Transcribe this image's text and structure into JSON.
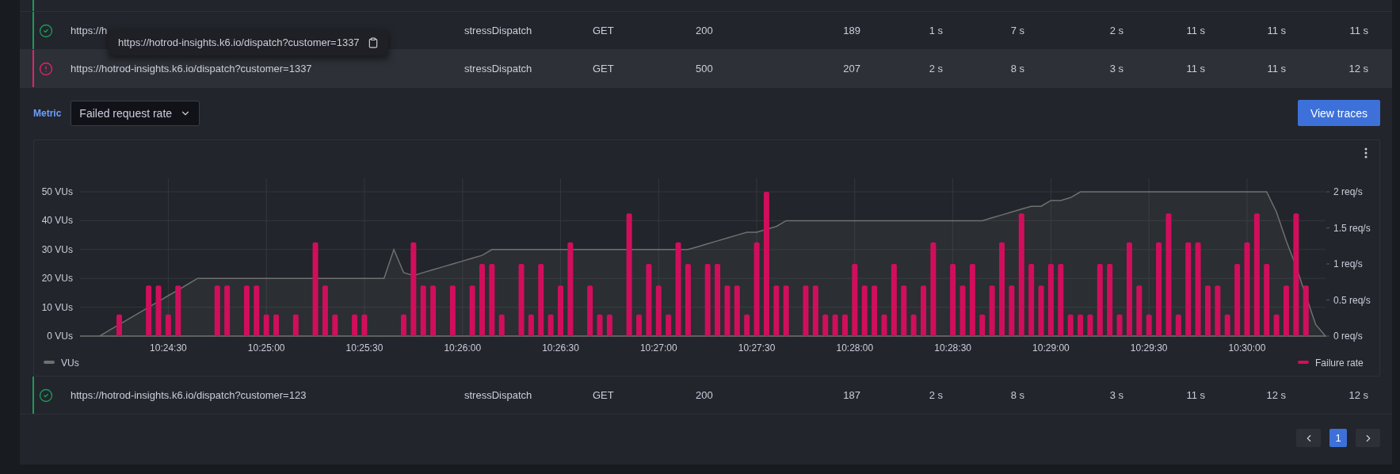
{
  "previous_row": {
    "color": "#1a9a5a"
  },
  "tooltip": {
    "text": "https://hotrod-insights.k6.io/dispatch?customer=1337"
  },
  "table": {
    "rows": [
      {
        "kind": "success",
        "color": "#1a9a5a",
        "expanded": false,
        "cells": [
          "https://h",
          "stressDispatch",
          "GET",
          "200",
          "189",
          "1 s",
          "7 s",
          "2 s",
          "11 s",
          "11 s",
          "11 s"
        ]
      },
      {
        "kind": "error",
        "color": "#e0226e",
        "expanded": true,
        "cells": [
          "https://hotrod-insights.k6.io/dispatch?customer=1337",
          "stressDispatch",
          "GET",
          "500",
          "207",
          "2 s",
          "8 s",
          "3 s",
          "11 s",
          "11 s",
          "12 s"
        ]
      },
      {
        "kind": "success",
        "color": "#1a9a5a",
        "expanded": false,
        "cells": [
          "https://hotrod-insights.k6.io/dispatch?customer=123",
          "stressDispatch",
          "GET",
          "200",
          "187",
          "2 s",
          "8 s",
          "3 s",
          "11 s",
          "12 s",
          "12 s"
        ]
      }
    ]
  },
  "detail": {
    "metric_label": "Metric",
    "metric_select": {
      "value": "Failed request rate"
    },
    "view_traces_button": "View traces",
    "chart_data": {
      "type": "bar",
      "grid": true,
      "legend": "bottom",
      "ylim": [
        0,
        50
      ],
      "y2lim": [
        0,
        2
      ],
      "categories": [
        null,
        null,
        null,
        null,
        null,
        null,
        null,
        null,
        null,
        "10:24:30",
        null,
        null,
        null,
        null,
        null,
        null,
        null,
        null,
        null,
        "10:25:00",
        null,
        null,
        null,
        null,
        null,
        null,
        null,
        null,
        null,
        "10:25:30",
        null,
        null,
        null,
        null,
        null,
        null,
        null,
        null,
        null,
        "10:26:00",
        null,
        null,
        null,
        null,
        null,
        null,
        null,
        null,
        null,
        "10:26:30",
        null,
        null,
        null,
        null,
        null,
        null,
        null,
        null,
        null,
        "10:27:00",
        null,
        null,
        null,
        null,
        null,
        null,
        null,
        null,
        null,
        "10:27:30",
        null,
        null,
        null,
        null,
        null,
        null,
        null,
        null,
        null,
        "10:28:00",
        null,
        null,
        null,
        null,
        null,
        null,
        null,
        null,
        null,
        "10:28:30",
        null,
        null,
        null,
        null,
        null,
        null,
        null,
        null,
        null,
        "10:29:00",
        null,
        null,
        null,
        null,
        null,
        null,
        null,
        null,
        null,
        "10:29:30",
        null,
        null,
        null,
        null,
        null,
        null,
        null,
        null,
        null,
        "10:30:00",
        null,
        null,
        null,
        null,
        null,
        null,
        null,
        null
      ],
      "yticks": [
        {
          "value": 0,
          "label": "0 VUs"
        },
        {
          "value": 10,
          "label": "10 VUs"
        },
        {
          "value": 20,
          "label": "20 VUs"
        },
        {
          "value": 30,
          "label": "30 VUs"
        },
        {
          "value": 40,
          "label": "40 VUs"
        },
        {
          "value": 50,
          "label": "50 VUs"
        }
      ],
      "y2ticks": [
        {
          "value": 0,
          "label": "0 req/s"
        },
        {
          "value": 0.5,
          "label": "0.5 req/s"
        },
        {
          "value": 1,
          "label": "1 req/s"
        },
        {
          "value": 1.5,
          "label": "1.5 req/s"
        },
        {
          "value": 2,
          "label": "2 req/s"
        }
      ],
      "series": [
        {
          "name": "VUs",
          "type": "area",
          "color": "#707070",
          "values": [
            0,
            0,
            0,
            2,
            4,
            6,
            8,
            10,
            12,
            14,
            16,
            18,
            20,
            20,
            20,
            20,
            20,
            20,
            20,
            20,
            20,
            20,
            20,
            20,
            20,
            20,
            20,
            20,
            20,
            20,
            20,
            20,
            30,
            22,
            21,
            22,
            23,
            24,
            25,
            26,
            27,
            28,
            30,
            30,
            30,
            30,
            30,
            30,
            30,
            30,
            30,
            30,
            30,
            30,
            30,
            30,
            30,
            30,
            30,
            30,
            30,
            30,
            30,
            31,
            32,
            33,
            34,
            35,
            36,
            36,
            37,
            38,
            40,
            40,
            40,
            40,
            40,
            40,
            40,
            40,
            40,
            40,
            40,
            40,
            40,
            40,
            40,
            40,
            40,
            40,
            40,
            40,
            40,
            41,
            42,
            43,
            44,
            45,
            45,
            47,
            47,
            48,
            50,
            50,
            50,
            50,
            50,
            50,
            50,
            50,
            50,
            50,
            50,
            50,
            50,
            50,
            50,
            50,
            50,
            50,
            50,
            50,
            43,
            33,
            24,
            14,
            4,
            0
          ]
        },
        {
          "name": "Failure rate",
          "type": "bar",
          "axis": "y2",
          "color": "#d10e5c",
          "values": [
            null,
            null,
            null,
            null,
            0.3,
            null,
            null,
            0.7,
            0.7,
            0.3,
            0.7,
            null,
            null,
            null,
            0.7,
            0.7,
            null,
            0.7,
            0.7,
            0.3,
            0.3,
            null,
            0.3,
            null,
            1.3,
            0.7,
            0.3,
            null,
            0.3,
            0.3,
            null,
            null,
            null,
            0.3,
            1.3,
            0.7,
            0.7,
            null,
            0.7,
            null,
            0.7,
            1,
            1,
            0.3,
            null,
            1,
            0.3,
            1,
            0.3,
            0.7,
            1.3,
            null,
            0.7,
            0.3,
            0.3,
            null,
            1.7,
            0.3,
            1,
            0.7,
            0.3,
            1.3,
            1,
            null,
            1,
            1,
            0.7,
            0.7,
            0.3,
            1.3,
            2,
            0.7,
            0.7,
            null,
            0.7,
            0.7,
            0.3,
            0.3,
            0.3,
            1,
            0.7,
            0.7,
            0.3,
            1,
            0.7,
            0.3,
            0.7,
            1.3,
            null,
            1,
            0.7,
            1,
            0.3,
            0.7,
            1.3,
            0.7,
            1.7,
            1,
            0.7,
            1,
            1,
            0.3,
            0.3,
            0.3,
            1,
            1,
            0.3,
            1.3,
            0.7,
            0.3,
            1.3,
            1.7,
            0.3,
            1.3,
            1.3,
            0.7,
            0.7,
            0.3,
            1,
            1.3,
            1.7,
            1,
            0.3,
            0.7,
            1.7,
            0.7,
            null,
            null
          ]
        }
      ]
    }
  },
  "pagination": {
    "pages": [
      {
        "label": "1",
        "selected": true
      }
    ]
  }
}
